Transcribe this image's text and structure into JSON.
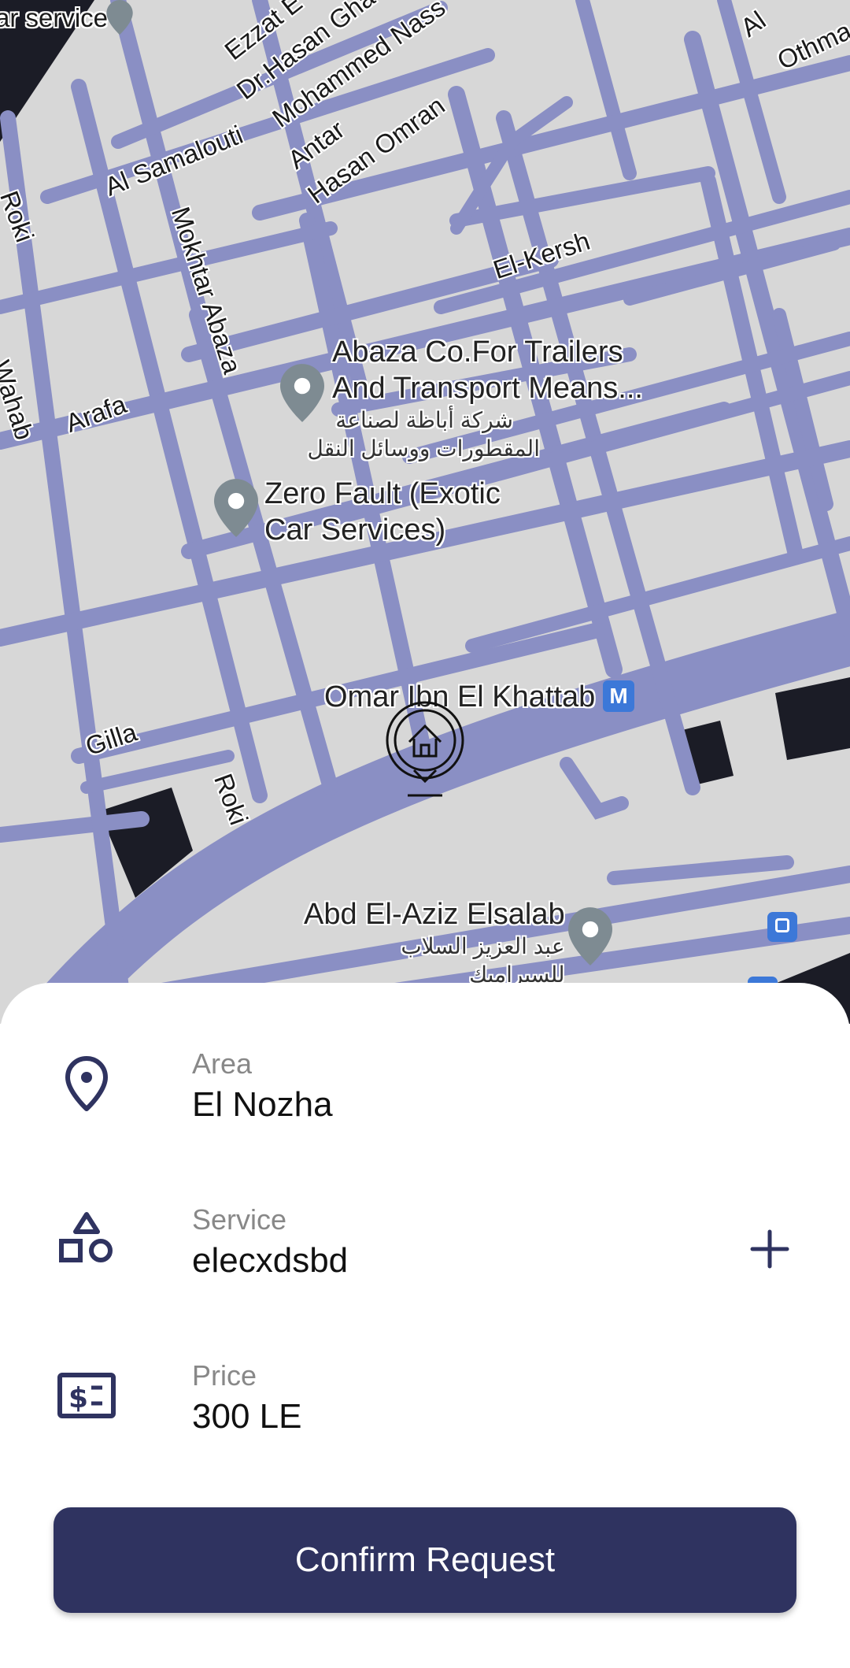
{
  "map": {
    "street_labels": {
      "ezzat": "Ezzat E",
      "dr_hasan": "Dr.Hasan Gha",
      "mohammed_nass": "Mohammed Nass",
      "al_samalouti": "Al Samalouti",
      "antar": "Antar",
      "hasan_omran": "Hasan Omran",
      "roki_top": "Roki",
      "mokhtar_abaza": "Mokhtar Abaza",
      "el_kersh": "El-Kersh",
      "wahab": "Wahab",
      "arafa": "Arafa",
      "gilla": "Gilla",
      "roki_bottom": "Roki",
      "othman": "Othma",
      "al": "Al",
      "car_service": "ar service"
    },
    "pois": {
      "abaza_en": "Abaza Co.For Trailers\nAnd Transport Means...",
      "abaza_ar1": "شركة أباظة لصناعة",
      "abaza_ar2": "المقطورات ووسائل النقل",
      "zero_fault": "Zero Fault (Exotic\nCar Services)",
      "omar_station": "Omar Ibn El Khattab",
      "metro_badge": "M",
      "abd_el_aziz": "Abd El-Aziz Elsalab",
      "abd_el_aziz_ar1": "عبد العزيز السلاب",
      "abd_el_aziz_ar2": "للسيراميك"
    },
    "colors": {
      "background": "#d7d7d7",
      "road": "#8a8fc4",
      "building_dark": "#1b1c26",
      "pin": "#7e8b92"
    }
  },
  "details": {
    "area": {
      "label": "Area",
      "value": "El Nozha",
      "icon": "location-pin-icon"
    },
    "service": {
      "label": "Service",
      "value": "elecxdsbd",
      "icon": "shapes-icon",
      "action_icon": "plus-icon"
    },
    "price": {
      "label": "Price",
      "value": "300 LE",
      "icon": "money-bill-icon"
    }
  },
  "actions": {
    "confirm_label": "Confirm Request"
  },
  "colors": {
    "primary": "#2f3360",
    "label_gray": "#888888"
  }
}
